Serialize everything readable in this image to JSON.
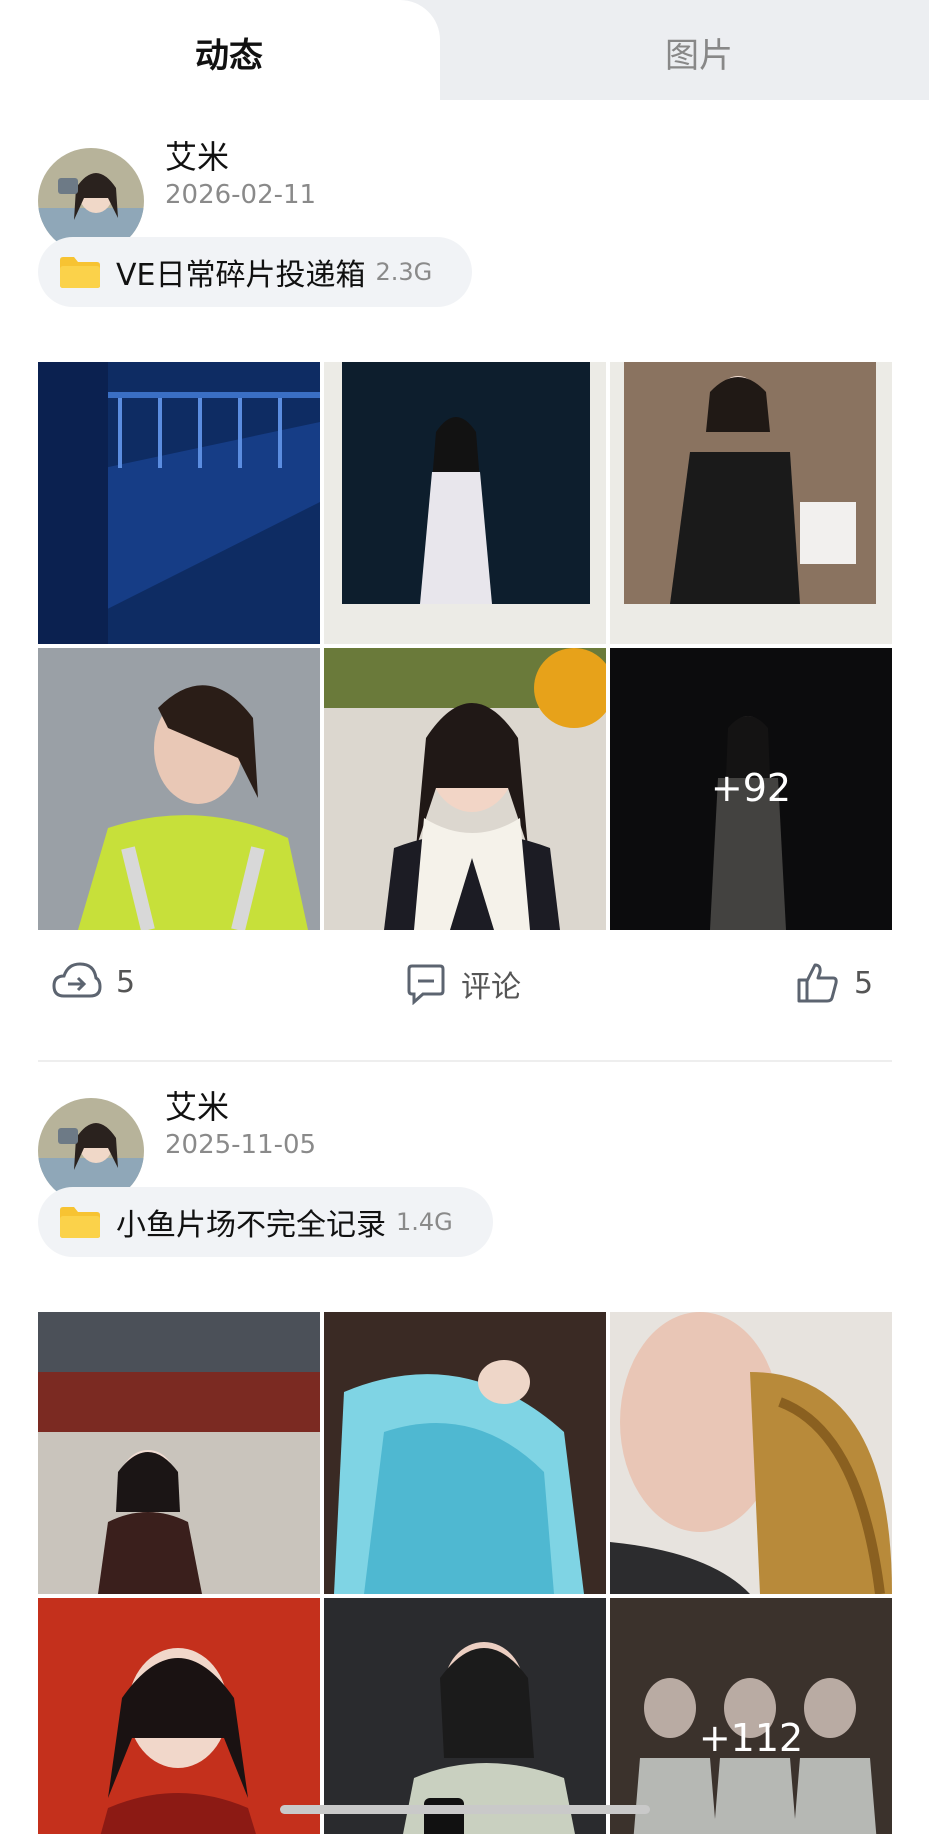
{
  "tabs": [
    {
      "label": "动态",
      "active": true
    },
    {
      "label": "图片",
      "active": false
    }
  ],
  "posts": [
    {
      "author": "艾米",
      "date": "2026-02-11",
      "folder": {
        "name": "VE日常碎片投递箱",
        "size": "2.3G"
      },
      "more_count": "+92",
      "actions": {
        "share_count": "5",
        "comment_label": "评论",
        "like_count": "5"
      }
    },
    {
      "author": "艾米",
      "date": "2025-11-05",
      "folder": {
        "name": "小鱼片场不完全记录",
        "size": "1.4G"
      },
      "more_count": "+112"
    }
  ],
  "colors": {
    "folder": "#f7c332",
    "icon": "#5c6470",
    "background": "#ffffff"
  }
}
